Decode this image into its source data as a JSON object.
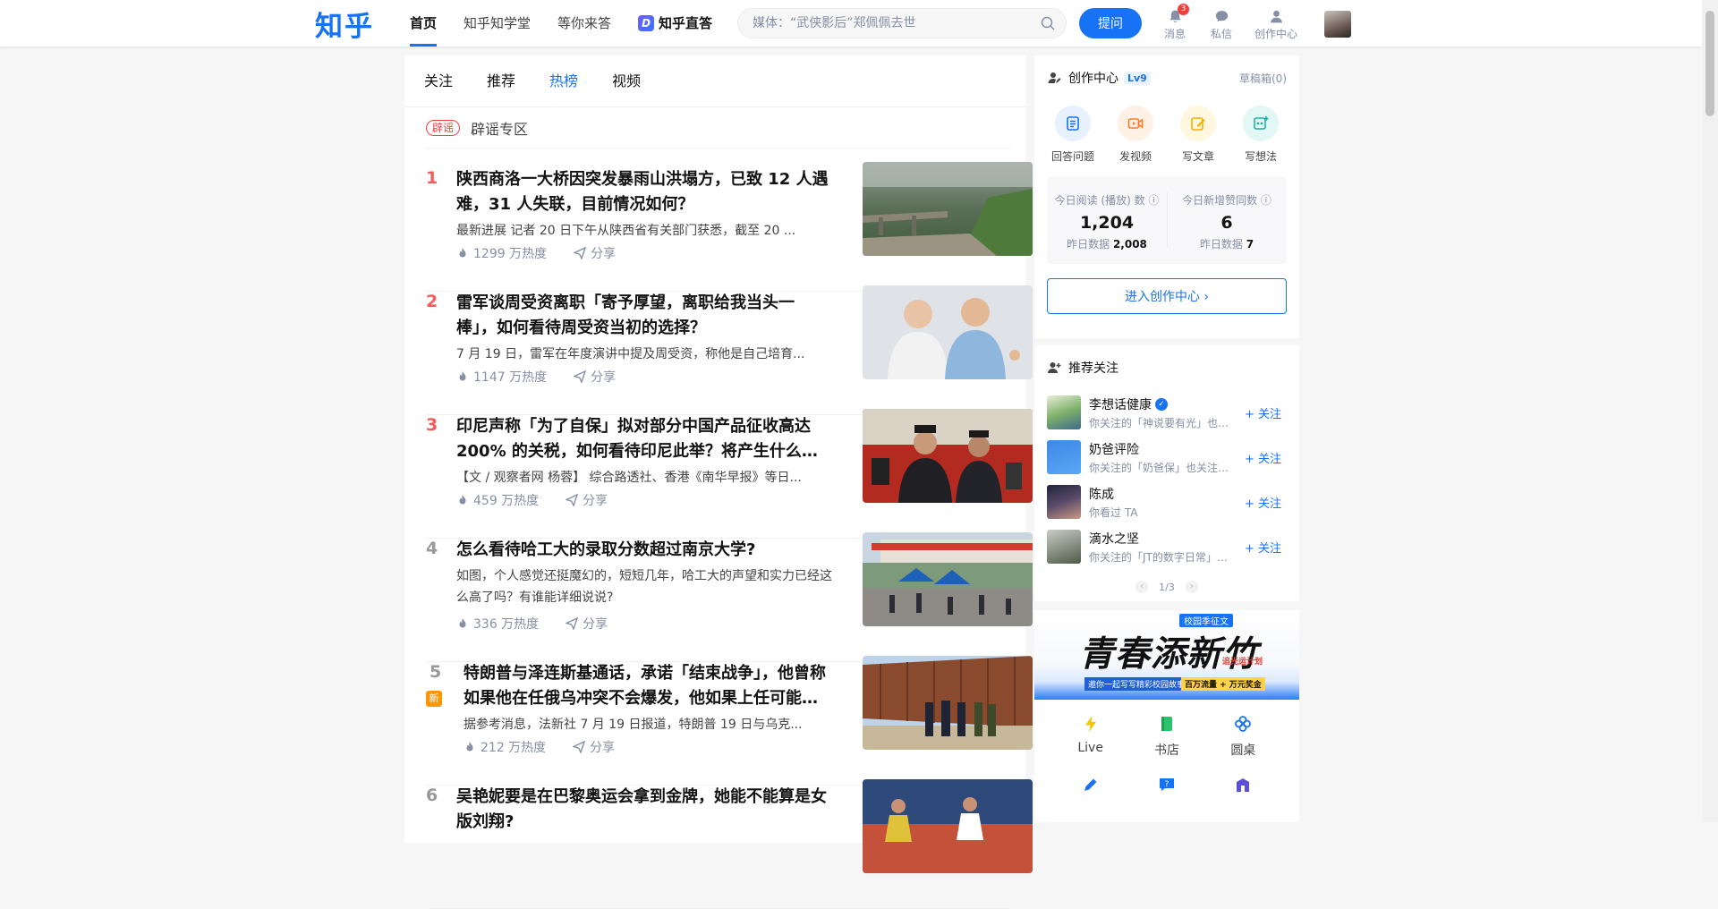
{
  "header": {
    "logo": "知乎",
    "nav": [
      {
        "label": "首页"
      },
      {
        "label": "知乎知学堂"
      },
      {
        "label": "等你来答"
      },
      {
        "label": "知乎直答"
      }
    ],
    "search_placeholder": "媒体：“武侠影后”郑佩佩去世",
    "ask_label": "提问",
    "icons": [
      {
        "label": "消息",
        "badge": "3",
        "icon": "bell-icon"
      },
      {
        "label": "私信",
        "icon": "chat-icon"
      },
      {
        "label": "创作中心",
        "icon": "user-icon"
      }
    ],
    "zd_mark": "D"
  },
  "feed": {
    "tabs": [
      "关注",
      "推荐",
      "热榜",
      "视频"
    ],
    "active_tab": "热榜",
    "rumor_tag": "辟谣",
    "rumor_label": "辟谣专区",
    "items": [
      {
        "rank": "1",
        "title": "陕西商洛一大桥因突发暴雨山洪塌方，已致 12 人遇难，31 人失联，目前情况如何？",
        "excerpt": "最新进展 记者 20 日下午从陕西省有关部门获悉，截至 20 ...",
        "heat": "1299 万热度",
        "share": "分享"
      },
      {
        "rank": "2",
        "title": "雷军谈周受资离职「寄予厚望，离职给我当头一棒」，如何看待周受资当初的选择？",
        "excerpt": "7 月 19 日，雷军在年度演讲中提及周受资，称他是自己培育...",
        "heat": "1147 万热度",
        "share": "分享"
      },
      {
        "rank": "3",
        "title": "印尼声称「为了自保」拟对部分中国产品征收高达 200% 的关税，如何看待印尼此举？将产生什么影响？",
        "excerpt": "【文 / 观察者网 杨蓉】 综合路透社、香港《南华早报》等日...",
        "heat": "459 万热度",
        "share": "分享"
      },
      {
        "rank": "4",
        "title": "怎么看待哈工大的录取分数超过南京大学?",
        "excerpt": "如图，个人感觉还挺魔幻的，短短几年，哈工大的声望和实力已经这么高了吗？有谁能详细说说?",
        "heat": "336 万热度",
        "share": "分享"
      },
      {
        "rank": "5",
        "new_tag": "新",
        "title": "特朗普与泽连斯基通话，承诺「结束战争」，他曾称如果他在任俄乌冲突不会爆发，他如果上任可能会怎么做？",
        "excerpt": "据参考消息，法新社 7 月 19 日报道，特朗普 19 日与乌克...",
        "heat": "212 万热度",
        "share": "分享"
      },
      {
        "rank": "6",
        "title": "吴艳妮要是在巴黎奥运会拿到金牌，她能不能算是女版刘翔?",
        "excerpt": "",
        "heat": "",
        "share": ""
      }
    ]
  },
  "creator": {
    "title": "创作中心",
    "level": "Lv9",
    "drafts": "草稿箱(0)",
    "actions": [
      "回答问题",
      "发视频",
      "写文章",
      "写想法"
    ],
    "stats": [
      {
        "label": "今日阅读 (播放) 数",
        "value": "1,204",
        "sub_label": "昨日数据",
        "sub_value": "2,008"
      },
      {
        "label": "今日新增赞同数",
        "value": "6",
        "sub_label": "昨日数据",
        "sub_value": "7"
      }
    ],
    "enter_label": "进入创作中心 ›"
  },
  "recommend": {
    "title": "推荐关注",
    "users": [
      {
        "name": "李想话健康",
        "desc": "你关注的「神说要有光」也关注了 TA",
        "verified": "✓",
        "follow": "+ 关注"
      },
      {
        "name": "奶爸评险",
        "desc": "你关注的「奶爸保」也关注了 TA",
        "follow": "+ 关注"
      },
      {
        "name": "陈成",
        "desc": "你看过 TA",
        "follow": "+ 关注"
      },
      {
        "name": "滴水之坚",
        "desc": "你关注的「JT的数字日常」也关注了 TA",
        "follow": "+ 关注"
      }
    ],
    "pager": "1/3",
    "prev": "‹",
    "next": "›"
  },
  "banner": {
    "tag": "校园季征文",
    "title": "青春添新竹",
    "plan": "追光运计划",
    "sub": "邀你一起写写精彩校园故事",
    "sub2": "百万流量 + 万元奖金"
  },
  "apps": [
    {
      "label": "Live",
      "icon": "bolt-icon"
    },
    {
      "label": "书店",
      "icon": "book-icon"
    },
    {
      "label": "圆桌",
      "icon": "flower-icon"
    }
  ]
}
